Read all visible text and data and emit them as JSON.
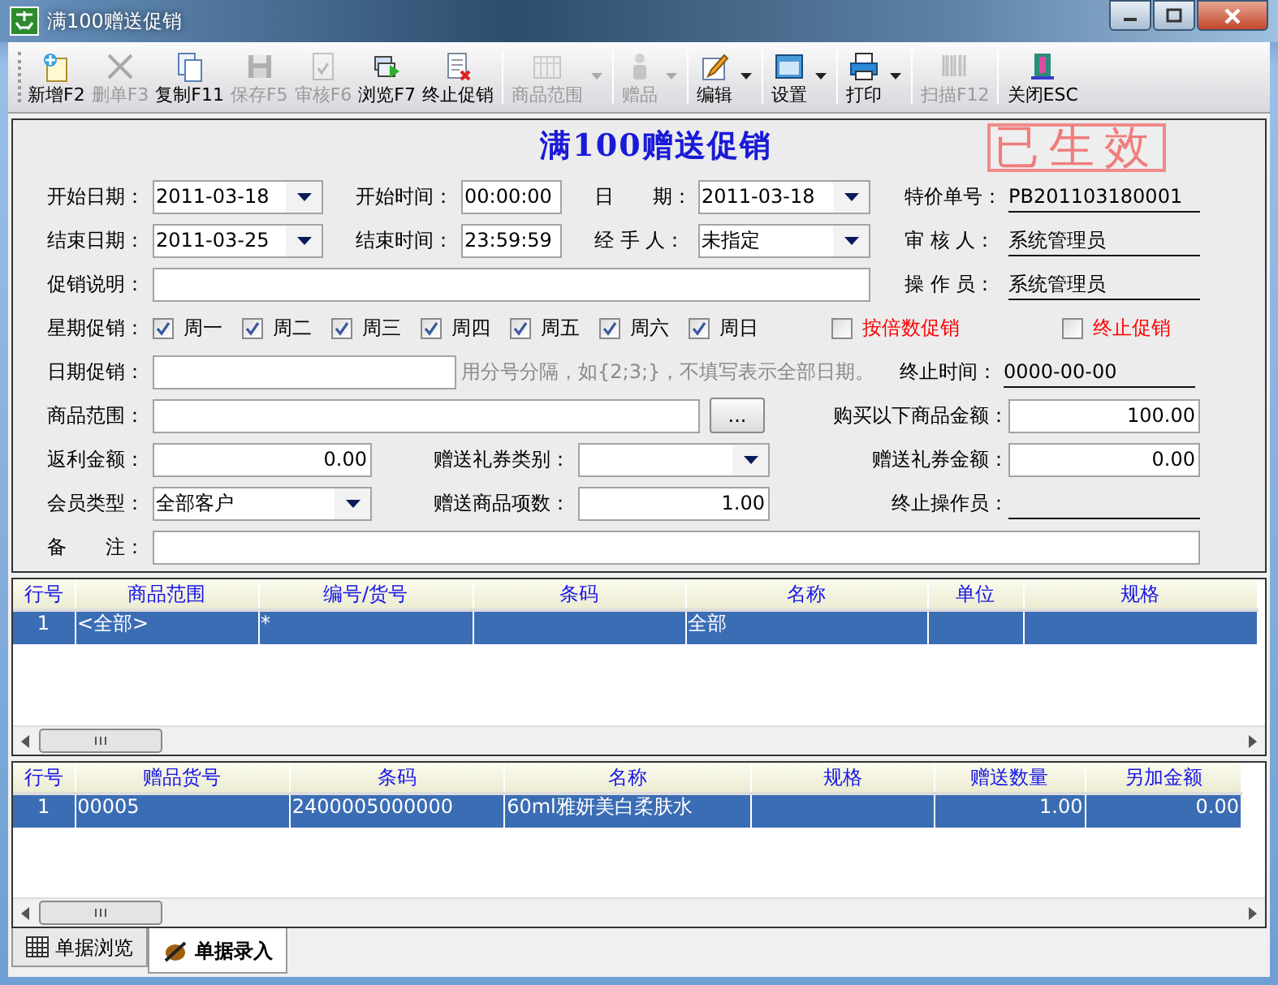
{
  "window": {
    "title": "满100赠送促销"
  },
  "toolbar": [
    {
      "label": "新增F2",
      "disabled": false,
      "dropdown": false
    },
    {
      "label": "删单F3",
      "disabled": true,
      "dropdown": false
    },
    {
      "label": "复制F11",
      "disabled": false,
      "dropdown": false
    },
    {
      "label": "保存F5",
      "disabled": true,
      "dropdown": false
    },
    {
      "label": "审核F6",
      "disabled": true,
      "dropdown": false
    },
    {
      "label": "浏览F7",
      "disabled": false,
      "dropdown": false
    },
    {
      "label": "终止促销",
      "disabled": false,
      "dropdown": false
    },
    {
      "label": "商品范围",
      "disabled": true,
      "dropdown": true
    },
    {
      "label": "赠品",
      "disabled": true,
      "dropdown": true
    },
    {
      "label": "编辑",
      "disabled": false,
      "dropdown": true
    },
    {
      "label": "设置",
      "disabled": false,
      "dropdown": true
    },
    {
      "label": "打印",
      "disabled": false,
      "dropdown": true
    },
    {
      "label": "扫描F12",
      "disabled": true,
      "dropdown": false
    },
    {
      "label": "关闭ESC",
      "disabled": false,
      "dropdown": false
    }
  ],
  "form": {
    "title": "满100赠送促销",
    "stamp": "已生效",
    "start_date": {
      "label": "开始日期：",
      "value": "2011-03-18"
    },
    "start_time": {
      "label": "开始时间：",
      "value": "00:00:00"
    },
    "date": {
      "label": "日　　期：",
      "value": "2011-03-18"
    },
    "order_no": {
      "label": "特价单号：",
      "value": "PB201103180001"
    },
    "end_date": {
      "label": "结束日期：",
      "value": "2011-03-25"
    },
    "end_time": {
      "label": "结束时间：",
      "value": "23:59:59"
    },
    "handler": {
      "label": "经 手 人：",
      "value": "未指定"
    },
    "auditor": {
      "label": "审 核 人：",
      "value": "系统管理员"
    },
    "description": {
      "label": "促销说明："
    },
    "operator": {
      "label": "操 作 员：",
      "value": "系统管理员"
    },
    "weekdays": {
      "label": "星期促销：",
      "days": [
        {
          "label": "周一",
          "checked": true
        },
        {
          "label": "周二",
          "checked": true
        },
        {
          "label": "周三",
          "checked": true
        },
        {
          "label": "周四",
          "checked": true
        },
        {
          "label": "周五",
          "checked": true
        },
        {
          "label": "周六",
          "checked": true
        },
        {
          "label": "周日",
          "checked": true
        }
      ]
    },
    "multiple_promo": {
      "label": "按倍数促销",
      "checked": false
    },
    "stop_promo": {
      "label": "终止促销",
      "checked": false
    },
    "date_promo": {
      "label": "日期促销：",
      "hint": "用分号分隔，如{2;3;}，不填写表示全部日期。"
    },
    "stop_time": {
      "label": "终止时间：",
      "value": "0000-00-00"
    },
    "goods_range": {
      "label": "商品范围：",
      "button": "..."
    },
    "purchase_amount": {
      "label": "购买以下商品金额：",
      "value": "100.00"
    },
    "rebate_amount": {
      "label": "返利金额：",
      "value": "0.00"
    },
    "coupon_type": {
      "label": "赠送礼券类别："
    },
    "coupon_amount": {
      "label": "赠送礼券金额：",
      "value": "0.00"
    },
    "member_type": {
      "label": "会员类型：",
      "value": "全部客户"
    },
    "gift_count": {
      "label": "赠送商品项数：",
      "value": "1.00"
    },
    "stop_operator": {
      "label": "终止操作员："
    },
    "remark": {
      "label": "备　　注："
    }
  },
  "range_table": {
    "columns": [
      "行号",
      "商品范围",
      "编号/货号",
      "条码",
      "名称",
      "单位",
      "规格"
    ],
    "rows": [
      {
        "selected": true,
        "cells": [
          "1",
          "<全部>",
          "*",
          null,
          "全部",
          null,
          null
        ]
      }
    ]
  },
  "gift_table": {
    "columns": [
      "行号",
      "赠品货号",
      "条码",
      "名称",
      "规格",
      "赠送数量",
      "另加金额"
    ],
    "rows": [
      {
        "selected": true,
        "cells": [
          "1",
          "00005",
          "2400005000000",
          "60ml雅妍美白柔肤水",
          null,
          "1.00",
          "0.00"
        ]
      }
    ]
  },
  "tabs": [
    {
      "label": "单据浏览",
      "selected": false
    },
    {
      "label": "单据录入",
      "selected": true
    }
  ]
}
